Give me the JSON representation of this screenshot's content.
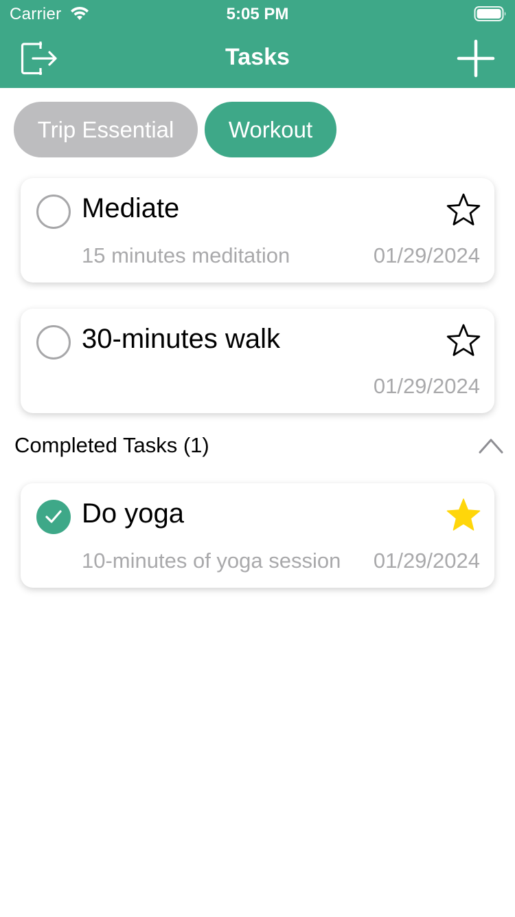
{
  "status_bar": {
    "carrier": "Carrier",
    "time": "5:05 PM",
    "icons": [
      "wifi-icon",
      "battery-icon"
    ]
  },
  "nav": {
    "title": "Tasks",
    "left_icon": "logout-icon",
    "right_icon": "plus-icon"
  },
  "categories": [
    {
      "label": "Trip Essential",
      "selected": false
    },
    {
      "label": "Workout",
      "selected": true
    }
  ],
  "tasks": [
    {
      "title": "Mediate",
      "description": "15 minutes meditation",
      "date": "01/29/2024",
      "starred": false,
      "completed": false
    },
    {
      "title": "30-minutes walk",
      "description": "",
      "date": "01/29/2024",
      "starred": false,
      "completed": false
    }
  ],
  "completed_section": {
    "title": "Completed Tasks (1)",
    "toggle_icon": "chevron-up-icon",
    "tasks": [
      {
        "title": "Do yoga",
        "description": "10-minutes of yoga session",
        "date": "01/29/2024",
        "starred": true,
        "completed": true
      }
    ]
  },
  "colors": {
    "brand": "#3ea888",
    "chip_inactive": "#bdbdbf",
    "secondary_text": "#a9a9ab",
    "star_active": "#ffd60a"
  }
}
